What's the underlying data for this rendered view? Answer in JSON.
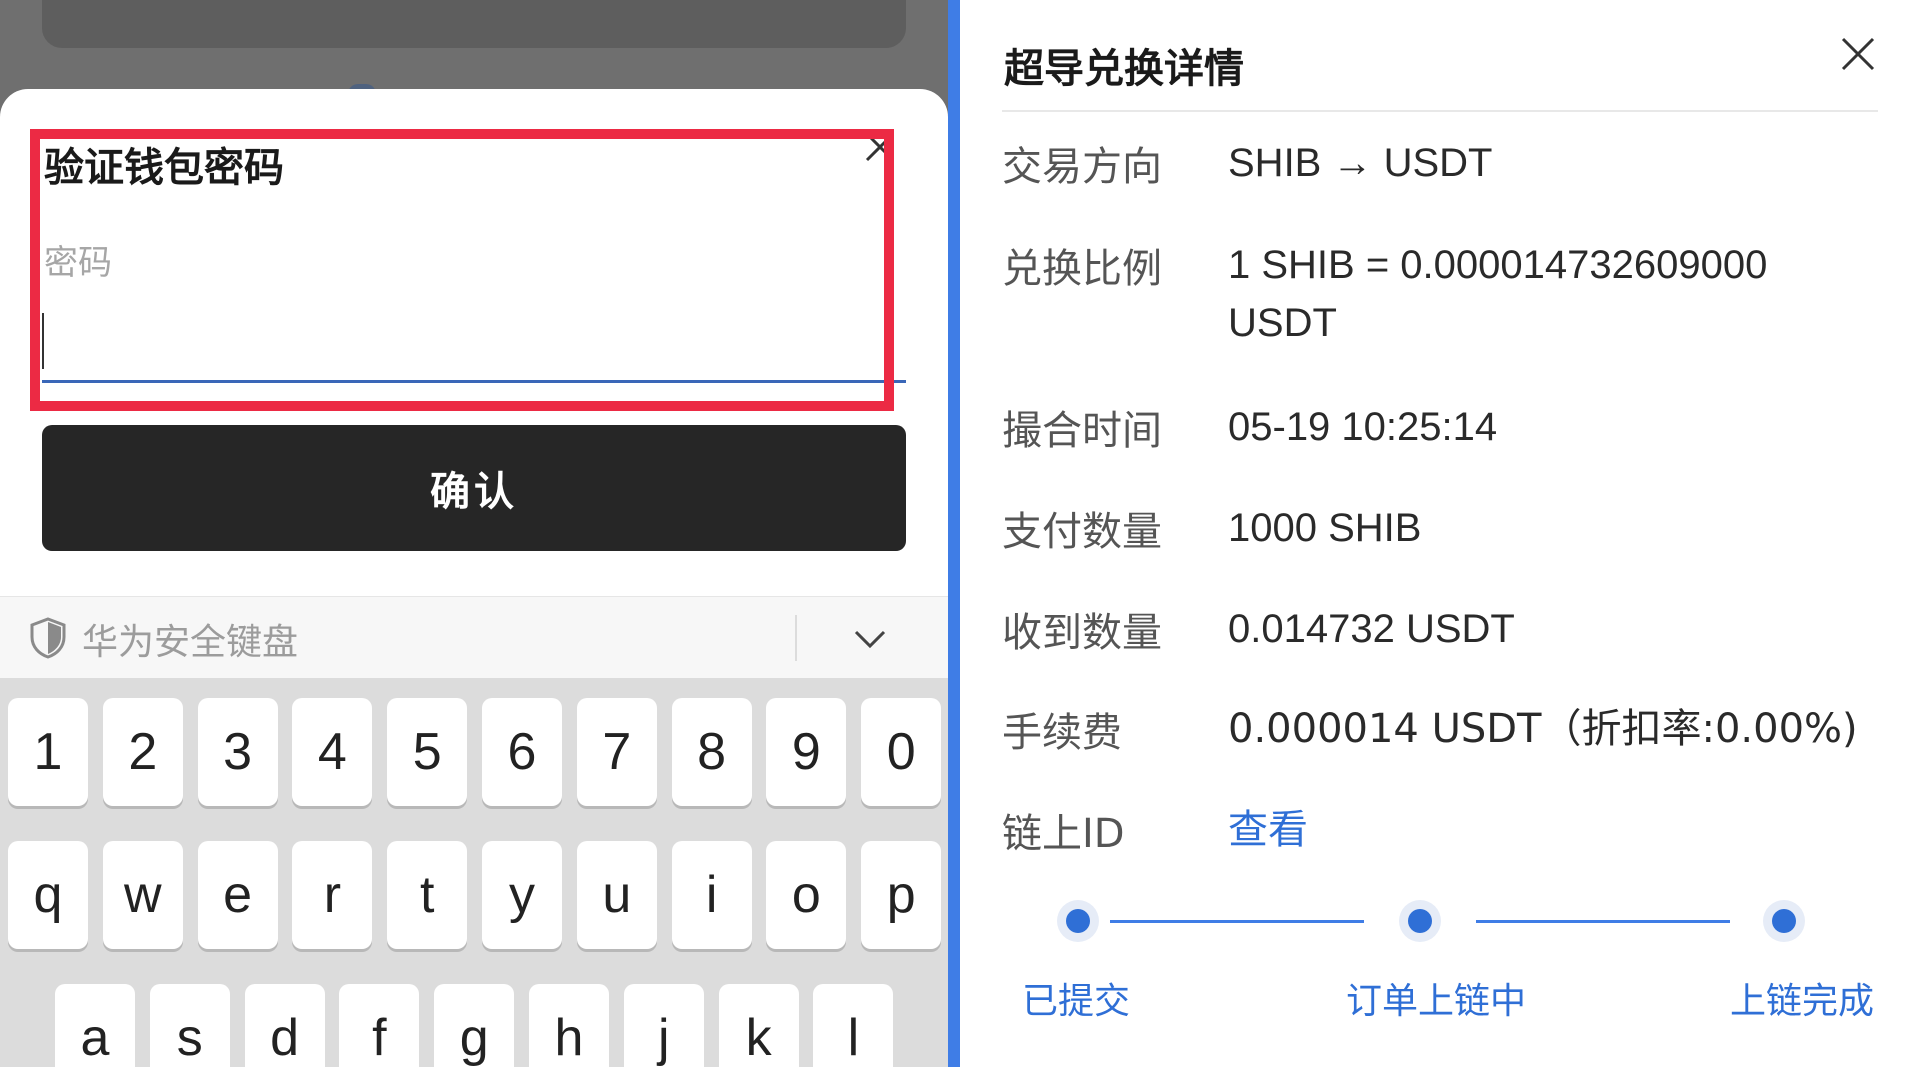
{
  "password_dialog": {
    "title": "验证钱包密码",
    "password_label": "密码",
    "password_value": "",
    "confirm_label": "确认"
  },
  "keyboard": {
    "name": "华为安全键盘",
    "row1": [
      "1",
      "2",
      "3",
      "4",
      "5",
      "6",
      "7",
      "8",
      "9",
      "0"
    ],
    "row2": [
      "q",
      "w",
      "e",
      "r",
      "t",
      "y",
      "u",
      "i",
      "o",
      "p"
    ],
    "row3": [
      "a",
      "s",
      "d",
      "f",
      "g",
      "h",
      "j",
      "k",
      "l"
    ]
  },
  "exchange_detail": {
    "title": "超导兑换详情",
    "rows": [
      {
        "label": "交易方向",
        "value": "SHIB → USDT"
      },
      {
        "label": "兑换比例",
        "value": "1 SHIB = 0.000014732609000 USDT"
      },
      {
        "label": "撮合时间",
        "value": "05-19 10:25:14"
      },
      {
        "label": "支付数量",
        "value": "1000 SHIB"
      },
      {
        "label": "收到数量",
        "value": "0.014732 USDT"
      },
      {
        "label": "手续费",
        "value": "0.000014 USDT（折扣率:0.00%)"
      },
      {
        "label": "链上ID",
        "value": "查看"
      }
    ],
    "steps": [
      "已提交",
      "订单上链中",
      "上链完成"
    ]
  },
  "colors": {
    "accent": "#2f6fd6",
    "highlight": "#ec2a44",
    "separator": "#3f7de6",
    "button_dark": "#262626"
  },
  "icons": [
    "close-icon",
    "shield-icon",
    "chevron-down-icon"
  ]
}
